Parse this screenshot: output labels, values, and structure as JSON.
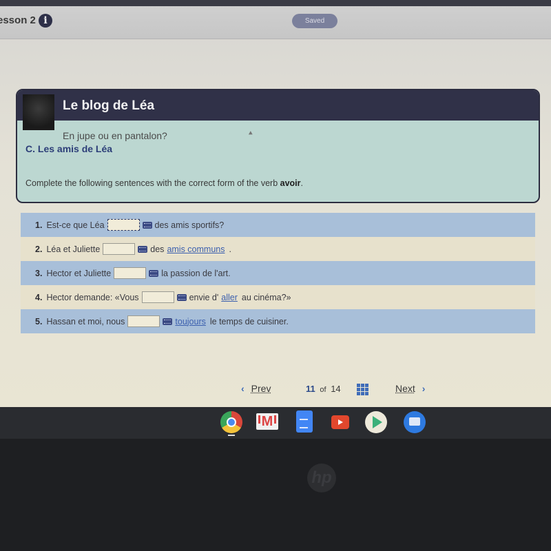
{
  "header": {
    "lesson_title": "esson 2",
    "info_icon_glyph": "i",
    "saved_label": "Saved"
  },
  "card": {
    "blog_title": "Le blog de Léa",
    "subtitle": "En jupe ou en pantalon?",
    "section_title": "C. Les amis de Léa",
    "instruction_prefix": "Complete the following sentences with the correct form of the verb ",
    "instruction_verb": "avoir",
    "instruction_suffix": "."
  },
  "exercises": [
    {
      "number": "1.",
      "before": "Est-ce que Léa",
      "answer": "",
      "after": "des amis sportifs?",
      "link": "",
      "after_link": ""
    },
    {
      "number": "2.",
      "before": "Léa et Juliette",
      "answer": "",
      "after": "des",
      "link": "amis communs",
      "after_link": "."
    },
    {
      "number": "3.",
      "before": "Hector et Juliette",
      "answer": "",
      "after": "la passion de l'art.",
      "link": "",
      "after_link": ""
    },
    {
      "number": "4.",
      "before": "Hector demande: «Vous",
      "answer": "",
      "after": "envie d'",
      "link": "aller",
      "after_link": "au cinéma?»"
    },
    {
      "number": "5.",
      "before": "Hassan et moi, nous",
      "answer": "",
      "after": "",
      "link": "toujours",
      "after_link": "le temps de cuisiner."
    }
  ],
  "pager": {
    "prev_label": "Prev",
    "current_page": "11",
    "of_label": "of",
    "total_pages": "14",
    "next_label": "Next",
    "prev_glyph": "‹",
    "next_glyph": "›"
  },
  "shelf": {
    "apps": [
      "chrome-icon",
      "gmail-icon",
      "docs-icon",
      "youtube-icon",
      "play-store-icon",
      "messages-icon"
    ]
  },
  "bezel": {
    "logo_text": "hp"
  }
}
